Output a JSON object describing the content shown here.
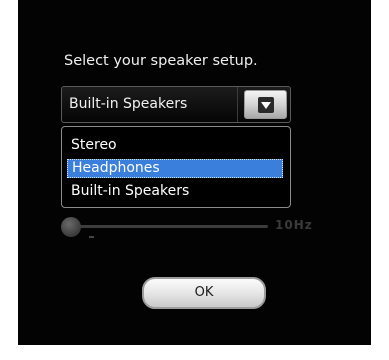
{
  "dialog": {
    "prompt": "Select your speaker setup.",
    "combo": {
      "selected_value": "Built-in Speakers",
      "dropdown_icon": "chevron-down-icon"
    },
    "options": [
      {
        "label": "Stereo",
        "selected": false
      },
      {
        "label": "Headphones",
        "selected": true
      },
      {
        "label": "Built-in Speakers",
        "selected": false
      }
    ],
    "slider": {
      "value_label": "10Hz"
    },
    "ok_label": "OK"
  },
  "colors": {
    "dialog_background": "#030303",
    "selection_highlight": "#3a7fdc",
    "text": "#f0f0f0"
  }
}
